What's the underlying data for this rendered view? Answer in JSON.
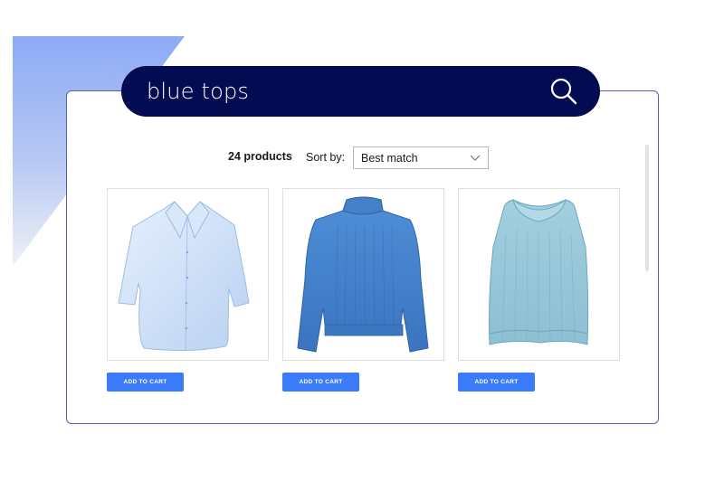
{
  "search": {
    "query": "blue tops"
  },
  "results": {
    "count_label": "24 products",
    "sort_label": "Sort by:",
    "sort_value": "Best match"
  },
  "products": [
    {
      "item": "shirt-image",
      "cart_label": "ADD TO CART"
    },
    {
      "item": "sweater-image",
      "cart_label": "ADD TO CART"
    },
    {
      "item": "vest-image",
      "cart_label": "ADD TO CART"
    }
  ],
  "colors": {
    "search_bar": "#030c52",
    "accent_button": "#3a7bfa",
    "card_border": "#5a5fa0"
  }
}
